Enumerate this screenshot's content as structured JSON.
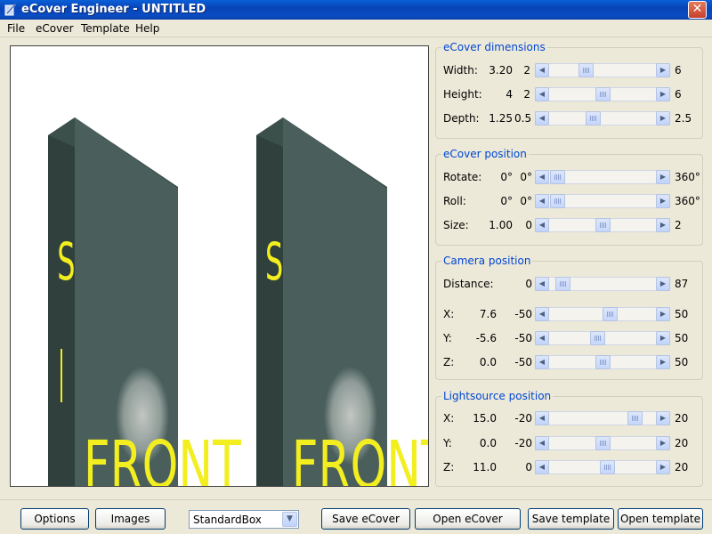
{
  "window": {
    "title": "eCover Engineer - UNTITLED",
    "close_label": "✕"
  },
  "menu": {
    "items": [
      "File",
      "eCover",
      "Template",
      "Help"
    ]
  },
  "preview": {
    "box_color": "#4a5f5b",
    "box_side_color": "#2f403d",
    "box_top_color": "#3b4f4b",
    "spine_text": "S",
    "front_text": "FRONT",
    "text_color": "#f2ee1f"
  },
  "groups": {
    "dimensions": {
      "title": "eCover dimensions",
      "rows": [
        {
          "label": "Width:",
          "value": "3.20",
          "min": "2",
          "max": "6",
          "position": 0.32
        },
        {
          "label": "Height:",
          "value": "4",
          "min": "2",
          "max": "6",
          "position": 0.5
        },
        {
          "label": "Depth:",
          "value": "1.25",
          "min": "0.5",
          "max": "2.5",
          "position": 0.4
        }
      ]
    },
    "position": {
      "title": "eCover position",
      "rows": [
        {
          "label": "Rotate:",
          "value": "0°",
          "min": "0°",
          "max": "360°",
          "position": 0.0
        },
        {
          "label": "Roll:",
          "value": "0°",
          "min": "0°",
          "max": "360°",
          "position": 0.0
        },
        {
          "label": "Size:",
          "value": "1.00",
          "min": "0",
          "max": "2",
          "position": 0.5
        }
      ]
    },
    "camera": {
      "title": "Camera position",
      "rows": [
        {
          "label": "Distance:",
          "value": "",
          "min": "0",
          "max": "87",
          "position": 0.06
        },
        {
          "label": "X:",
          "value": "7.6",
          "min": "-50",
          "max": "50",
          "position": 0.58
        },
        {
          "label": "Y:",
          "value": "-5.6",
          "min": "-50",
          "max": "50",
          "position": 0.45
        },
        {
          "label": "Z:",
          "value": "0.0",
          "min": "-50",
          "max": "50",
          "position": 0.5
        }
      ]
    },
    "light": {
      "title": "Lightsource position",
      "rows": [
        {
          "label": "X:",
          "value": "15.0",
          "min": "-20",
          "max": "20",
          "position": 0.86
        },
        {
          "label": "Y:",
          "value": "0.0",
          "min": "-20",
          "max": "20",
          "position": 0.5
        },
        {
          "label": "Z:",
          "value": "11.0",
          "min": "0",
          "max": "20",
          "position": 0.55
        }
      ]
    }
  },
  "bottom": {
    "options_label": "Options",
    "images_label": "Images",
    "template_selected": "StandardBox",
    "save_ecover_label": "Save eCover",
    "open_ecover_label": "Open eCover",
    "save_template_label": "Save template",
    "open_template_label": "Open template"
  }
}
